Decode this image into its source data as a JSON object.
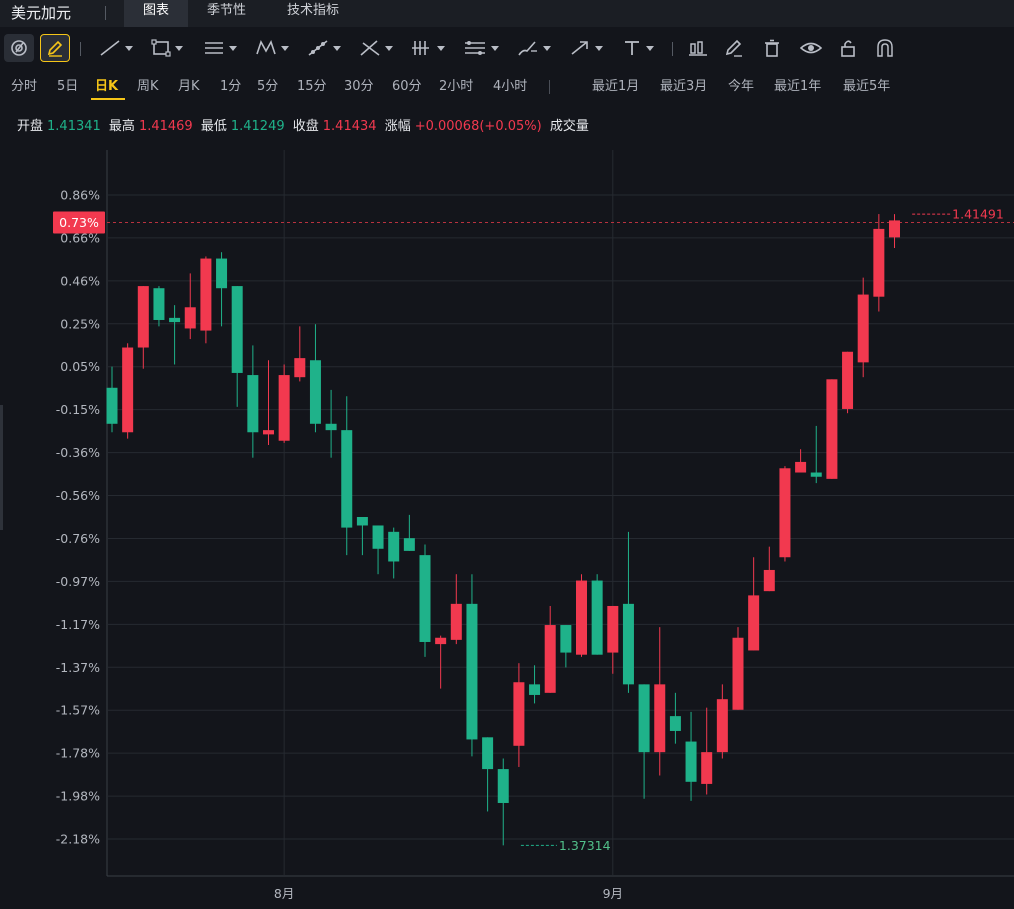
{
  "header": {
    "title": "美元加元",
    "tabs": [
      {
        "label": "图表",
        "active": true
      },
      {
        "label": "季节性",
        "active": false
      },
      {
        "label": "技术指标",
        "active": false
      }
    ]
  },
  "toolbar": {
    "icons": [
      "cycle-icon",
      "pencil-icon",
      "line-icon",
      "rectangle-icon",
      "parallel-lines-icon",
      "pattern-icon",
      "fib-icon",
      "cross-lines-icon",
      "bars-icon",
      "levels-icon",
      "brush-icon",
      "arrow-icon",
      "text-icon",
      "chart-icon",
      "edit-icon",
      "delete-icon",
      "eye-icon",
      "lock-icon",
      "magnet-icon"
    ]
  },
  "periods": {
    "items": [
      "分时",
      "5日",
      "日K",
      "周K",
      "月K",
      "1分",
      "5分",
      "15分",
      "30分",
      "60分",
      "2小时",
      "4小时"
    ],
    "active": "日K",
    "ranges": [
      "最近1月",
      "最近3月",
      "今年",
      "最近1年",
      "最近5年"
    ]
  },
  "ohlc": {
    "open_label": "开盘",
    "open": "1.41341",
    "high_label": "最高",
    "high": "1.41469",
    "low_label": "最低",
    "low": "1.41249",
    "close_label": "收盘",
    "close": "1.41434",
    "change_label": "涨幅",
    "change": "+0.00068(+0.05%)",
    "volume_label": "成交量"
  },
  "colors": {
    "up": "#f2394f",
    "down": "#1fb28a",
    "background": "#13151b",
    "grid": "#262a31",
    "accent": "#f5c518"
  },
  "chart_data": {
    "type": "candlestick",
    "yaxis_ticks": [
      "0.86%",
      "0.66%",
      "0.46%",
      "0.25%",
      "0.05%",
      "-0.15%",
      "-0.36%",
      "-0.56%",
      "-0.76%",
      "-0.97%",
      "-1.17%",
      "-1.37%",
      "-1.57%",
      "-1.78%",
      "-1.98%",
      "-2.18%"
    ],
    "ylim": [
      -2.18,
      0.86
    ],
    "xaxis_ticks": [
      {
        "label": "8月",
        "index": 11
      },
      {
        "label": "9月",
        "index": 32
      }
    ],
    "current_value_label": "0.73%",
    "current_value": 0.73,
    "max_annotation": {
      "index": 51,
      "value": 0.77,
      "label": "1.41491"
    },
    "min_annotation": {
      "index": 26,
      "value": -2.21,
      "label": "1.37314"
    },
    "candles": [
      {
        "o": -0.05,
        "h": 0.05,
        "l": -0.26,
        "c": -0.22
      },
      {
        "o": -0.26,
        "h": 0.16,
        "l": -0.29,
        "c": 0.14
      },
      {
        "o": 0.14,
        "h": 0.43,
        "l": 0.04,
        "c": 0.43
      },
      {
        "o": 0.42,
        "h": 0.43,
        "l": 0.24,
        "c": 0.27
      },
      {
        "o": 0.28,
        "h": 0.34,
        "l": 0.06,
        "c": 0.26
      },
      {
        "o": 0.23,
        "h": 0.49,
        "l": 0.18,
        "c": 0.33
      },
      {
        "o": 0.22,
        "h": 0.57,
        "l": 0.16,
        "c": 0.56
      },
      {
        "o": 0.56,
        "h": 0.59,
        "l": 0.24,
        "c": 0.42
      },
      {
        "o": 0.43,
        "h": 0.43,
        "l": -0.14,
        "c": 0.02
      },
      {
        "o": 0.01,
        "h": 0.15,
        "l": -0.38,
        "c": -0.26
      },
      {
        "o": -0.27,
        "h": 0.08,
        "l": -0.32,
        "c": -0.25
      },
      {
        "o": -0.3,
        "h": 0.06,
        "l": -0.31,
        "c": 0.01
      },
      {
        "o": 0.0,
        "h": 0.24,
        "l": -0.02,
        "c": 0.09
      },
      {
        "o": 0.08,
        "h": 0.25,
        "l": -0.26,
        "c": -0.22
      },
      {
        "o": -0.22,
        "h": -0.06,
        "l": -0.38,
        "c": -0.25
      },
      {
        "o": -0.25,
        "h": -0.09,
        "l": -0.84,
        "c": -0.71
      },
      {
        "o": -0.66,
        "h": -0.66,
        "l": -0.84,
        "c": -0.7
      },
      {
        "o": -0.7,
        "h": -0.76,
        "l": -0.93,
        "c": -0.81
      },
      {
        "o": -0.73,
        "h": -0.71,
        "l": -0.95,
        "c": -0.87
      },
      {
        "o": -0.76,
        "h": -0.65,
        "l": -0.82,
        "c": -0.82
      },
      {
        "o": -0.84,
        "h": -0.79,
        "l": -1.32,
        "c": -1.25
      },
      {
        "o": -1.26,
        "h": -1.22,
        "l": -1.47,
        "c": -1.23
      },
      {
        "o": -1.24,
        "h": -0.93,
        "l": -1.26,
        "c": -1.07
      },
      {
        "o": -1.07,
        "h": -0.93,
        "l": -1.79,
        "c": -1.71
      },
      {
        "o": -1.7,
        "h": -1.7,
        "l": -2.05,
        "c": -1.85
      },
      {
        "o": -1.85,
        "h": -1.8,
        "l": -2.21,
        "c": -2.01
      },
      {
        "o": -1.74,
        "h": -1.35,
        "l": -1.84,
        "c": -1.44
      },
      {
        "o": -1.45,
        "h": -1.36,
        "l": -1.54,
        "c": -1.5
      },
      {
        "o": -1.49,
        "h": -1.08,
        "l": -1.49,
        "c": -1.17
      },
      {
        "o": -1.17,
        "h": -1.21,
        "l": -1.37,
        "c": -1.3
      },
      {
        "o": -1.31,
        "h": -0.93,
        "l": -1.32,
        "c": -0.96
      },
      {
        "o": -0.96,
        "h": -0.93,
        "l": -1.31,
        "c": -1.31
      },
      {
        "o": -1.3,
        "h": -1.35,
        "l": -1.4,
        "c": -1.08
      },
      {
        "o": -1.07,
        "h": -0.73,
        "l": -1.49,
        "c": -1.45
      },
      {
        "o": -1.45,
        "h": -1.45,
        "l": -1.99,
        "c": -1.77
      },
      {
        "o": -1.77,
        "h": -1.18,
        "l": -1.88,
        "c": -1.45
      },
      {
        "o": -1.6,
        "h": -1.49,
        "l": -1.73,
        "c": -1.67
      },
      {
        "o": -1.72,
        "h": -1.58,
        "l": -2.0,
        "c": -1.91
      },
      {
        "o": -1.92,
        "h": -1.56,
        "l": -1.97,
        "c": -1.77
      },
      {
        "o": -1.77,
        "h": -1.45,
        "l": -1.8,
        "c": -1.52
      },
      {
        "o": -1.57,
        "h": -1.18,
        "l": -1.57,
        "c": -1.23
      },
      {
        "o": -1.29,
        "h": -0.85,
        "l": -1.29,
        "c": -1.03
      },
      {
        "o": -1.01,
        "h": -0.8,
        "l": -1.01,
        "c": -0.91
      },
      {
        "o": -0.85,
        "h": -0.42,
        "l": -0.87,
        "c": -0.43
      },
      {
        "o": -0.45,
        "h": -0.34,
        "l": -0.45,
        "c": -0.4
      },
      {
        "o": -0.45,
        "h": -0.23,
        "l": -0.5,
        "c": -0.47
      },
      {
        "o": -0.48,
        "h": -0.01,
        "l": -0.48,
        "c": -0.01
      },
      {
        "o": -0.15,
        "h": 0.12,
        "l": -0.17,
        "c": 0.12
      },
      {
        "o": 0.07,
        "h": 0.47,
        "l": 0.0,
        "c": 0.39
      },
      {
        "o": 0.38,
        "h": 0.77,
        "l": 0.31,
        "c": 0.7
      },
      {
        "o": 0.66,
        "h": 0.77,
        "l": 0.61,
        "c": 0.74
      }
    ]
  }
}
